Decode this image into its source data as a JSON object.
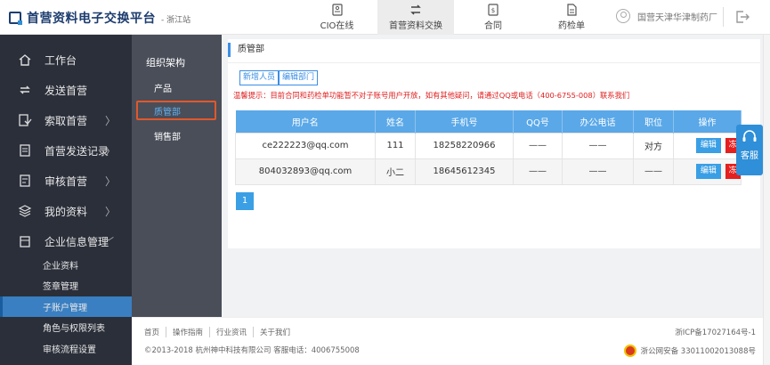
{
  "app": {
    "logo_text": "首营资料电子交换平台",
    "station": "- 浙江站"
  },
  "topnav": [
    {
      "label": "CIO在线",
      "icon": "id-card-icon",
      "active": false
    },
    {
      "label": "首营资料交换",
      "icon": "exchange-icon",
      "active": true
    },
    {
      "label": "合同",
      "icon": "contract-icon",
      "active": false
    },
    {
      "label": "药检单",
      "icon": "document-icon",
      "active": false
    }
  ],
  "user": {
    "company": "国营天津华津制药厂"
  },
  "sidebar": {
    "items": [
      {
        "label": "工作台",
        "icon": "home-icon",
        "chevron": ""
      },
      {
        "label": "发送首营",
        "icon": "send-icon",
        "chevron": ""
      },
      {
        "label": "索取首营",
        "icon": "request-icon",
        "chevron": "〉"
      },
      {
        "label": "首营发送记录",
        "icon": "clipboard-icon",
        "chevron": "〉"
      },
      {
        "label": "审核首营",
        "icon": "audit-icon",
        "chevron": "〉"
      },
      {
        "label": "我的资料",
        "icon": "layers-icon",
        "chevron": "〉"
      },
      {
        "label": "企业信息管理",
        "icon": "building-icon",
        "chevron": "﹀"
      }
    ],
    "subitems": [
      {
        "label": "企业资料",
        "active": false
      },
      {
        "label": "签章管理",
        "active": false
      },
      {
        "label": "子账户管理",
        "active": true
      },
      {
        "label": "角色与权限列表",
        "active": false
      },
      {
        "label": "审核流程设置",
        "active": false
      }
    ]
  },
  "org": {
    "title": "组织架构",
    "items": [
      {
        "label": "产品",
        "active": false
      },
      {
        "label": "质管部",
        "active": true
      },
      {
        "label": "销售部",
        "active": false
      }
    ]
  },
  "main": {
    "title": "质管部",
    "add_label": "新增人员",
    "edit_dept_label": "编辑部门",
    "notice": "温馨提示：目前合同和药检单功能暂不对子账号用户开放，如有其他疑问，请通过QQ或电话（400-6755-008）联系我们",
    "columns": [
      "用户名",
      "姓名",
      "手机号",
      "QQ号",
      "办公电话",
      "职位",
      "操作"
    ],
    "rows": [
      {
        "username": "ce222223@qq.com",
        "name": "111",
        "phone": "18258220966",
        "qq": "——",
        "office": "——",
        "position": "对方"
      },
      {
        "username": "804032893@qq.com",
        "name": "小二",
        "phone": "18645612345",
        "qq": "——",
        "office": "——",
        "position": "——"
      }
    ],
    "edit_label": "编辑",
    "delete_label": "冻结",
    "page": "1"
  },
  "service": {
    "label": "客服"
  },
  "footer": {
    "links": [
      "首页",
      "操作指南",
      "行业资讯",
      "关于我们"
    ],
    "copyright": "©2013-2018   杭州神中科技有限公司   客服电话：4006755008",
    "icp": "浙ICP备17027164号-1",
    "gongan": "浙公网安备 33011002013088号"
  },
  "colors": {
    "accent": "#3a9fe5",
    "sidebar": "#2b2f3a",
    "danger": "#e52020"
  }
}
